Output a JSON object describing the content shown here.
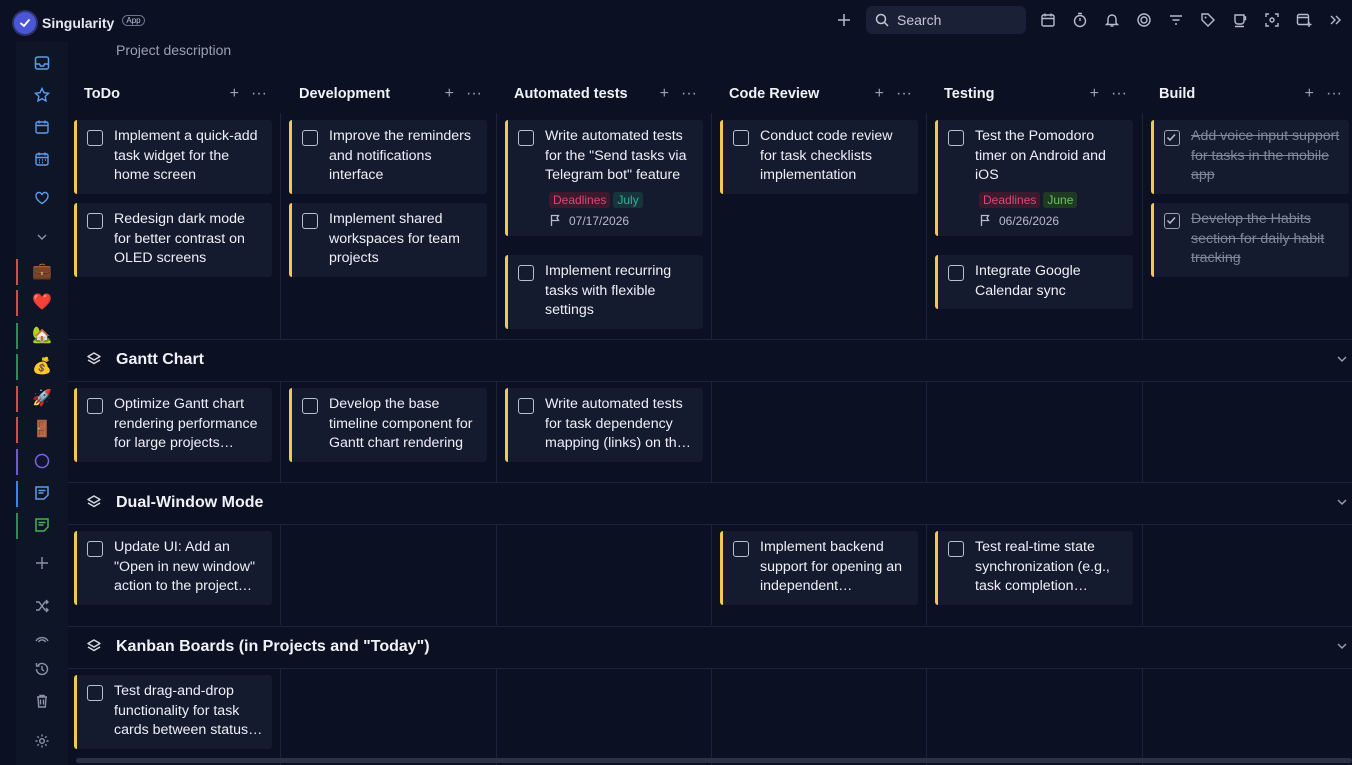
{
  "app": {
    "title": "Singularity",
    "badge": "App"
  },
  "toolbar": {
    "search_placeholder": "Search"
  },
  "project": {
    "description": "Project description"
  },
  "columns": [
    {
      "name": "ToDo"
    },
    {
      "name": "Development"
    },
    {
      "name": "Automated tests"
    },
    {
      "name": "Code Review"
    },
    {
      "name": "Testing"
    },
    {
      "name": "Build"
    }
  ],
  "groups": [
    {
      "title": "Gantt Chart"
    },
    {
      "title": "Dual-Window Mode"
    },
    {
      "title": "Kanban Boards (in Projects and \"Today\")"
    }
  ],
  "sidebar": {
    "projects": [
      "💼",
      "❤️",
      "🏡",
      "💰",
      "🚀",
      "🚪"
    ],
    "project_colors": [
      "#d94b4b",
      "#d94b4b",
      "#2e8b57",
      "#2e8b57",
      "#d94b4b",
      "#d94b4b"
    ]
  },
  "tasks": {
    "g0c0a": "Implement a quick-add task widget for the home screen",
    "g0c0b": "Redesign dark mode for better contrast on OLED screens",
    "g0c1a": "Improve the reminders and notifications interface",
    "g0c1b": "Implement shared workspaces for team projects",
    "g0c2a": "Write automated tests for the \"Send tasks via Telegram bot\" feature",
    "g0c2a_tag1": "Deadlines",
    "g0c2a_tag2": "July",
    "g0c2a_due": "07/17/2026",
    "g0c2b": "Implement recurring tasks with flexible settings",
    "g0c3a": "Conduct code review for task checklists implementation",
    "g0c4a": "Test the Pomodoro timer on Android and iOS",
    "g0c4a_tag1": "Deadlines",
    "g0c4a_tag2": "June",
    "g0c4a_due": "06/26/2026",
    "g0c4b": "Integrate Google Calendar sync",
    "g0c5a": "Add voice input support for tasks in the mobile app",
    "g0c5b": "Develop the Habits section for daily habit tracking",
    "g1c0a": "Optimize Gantt chart rendering performance for large projects…",
    "g1c1a": "Develop the base timeline component for Gantt chart rendering",
    "g1c2a": "Write automated tests for task dependency mapping (links) on th…",
    "g2c0a": "Update UI: Add an \"Open in new window\" action to the project…",
    "g2c3a": "Implement backend support for opening an independent…",
    "g2c4a": "Test real-time state synchronization (e.g., task completion…",
    "g3c0a": "Test drag-and-drop functionality for task cards between status…"
  }
}
